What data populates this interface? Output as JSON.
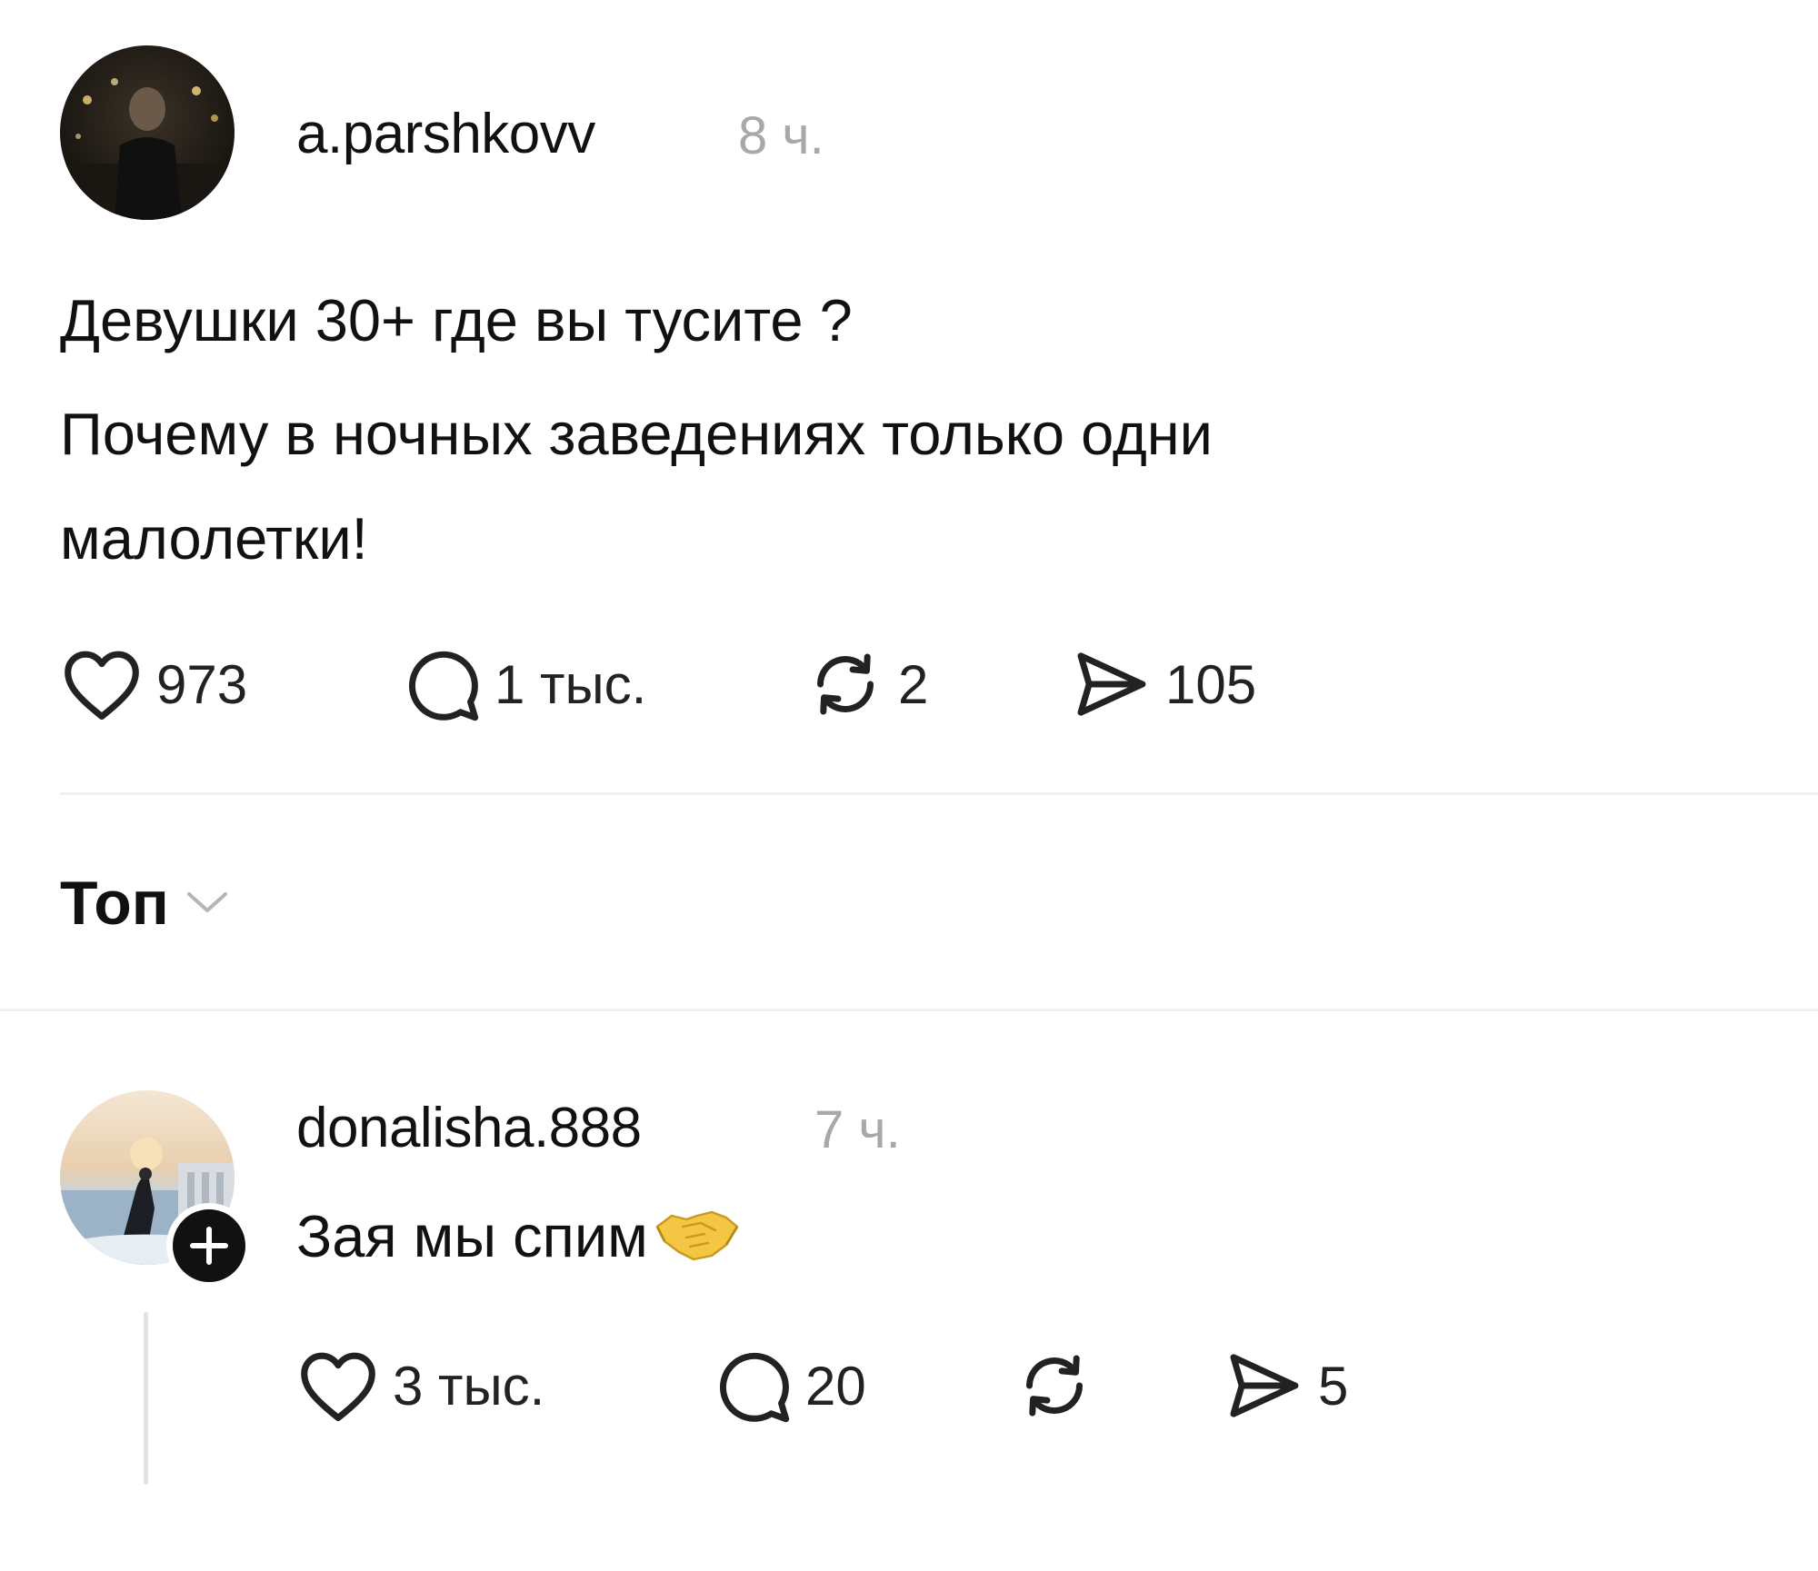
{
  "post": {
    "author": "a.parshkovv",
    "time": "8 ч.",
    "lines": [
      "Девушки 30+ где вы тусите ?",
      "Почему в ночных заведениях только  одни",
      "малолетки!"
    ],
    "actions": {
      "likes": "973",
      "comments": "1 тыс.",
      "reposts": "2",
      "shares": "105"
    }
  },
  "sort": {
    "label": "Топ"
  },
  "reply": {
    "author": "donalisha.888",
    "time": "7 ч.",
    "text": "Зая мы спим",
    "emoji": "handshake-emoji",
    "actions": {
      "likes": "3 тыс.",
      "comments": "20",
      "reposts": "",
      "shares": "5"
    }
  },
  "icons": {
    "like": "heart-icon",
    "comment": "speech-bubble-icon",
    "repost": "repost-arrows-icon",
    "share": "paper-plane-icon",
    "sort": "chevron-down-icon",
    "follow": "plus-icon"
  }
}
